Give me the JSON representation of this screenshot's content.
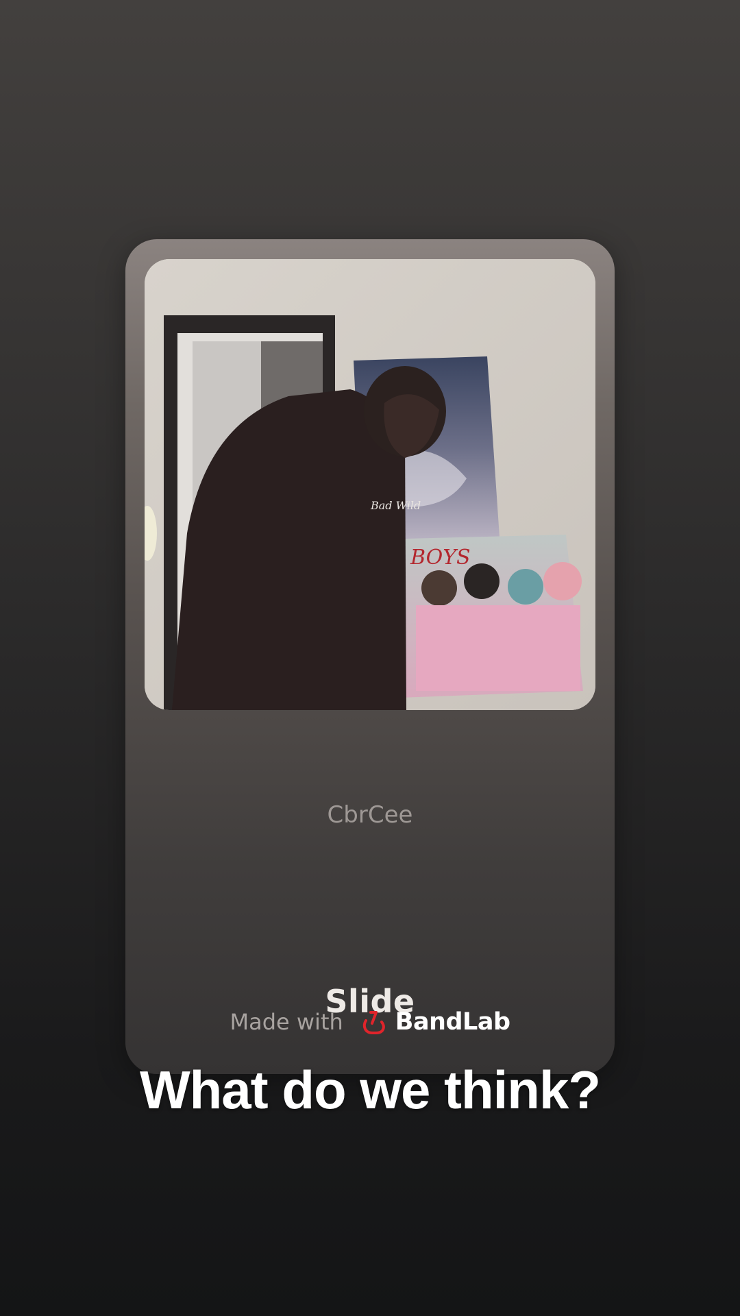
{
  "track": {
    "title": "Slide",
    "artist": "CbrCee"
  },
  "branding": {
    "made_with": "Made with",
    "brand_name": "BandLab",
    "brand_icon": "bandlab-logo-icon",
    "brand_color": "#e0242b"
  },
  "caption": "What do we think?",
  "cover": {
    "icon": "album-cover-photo"
  }
}
